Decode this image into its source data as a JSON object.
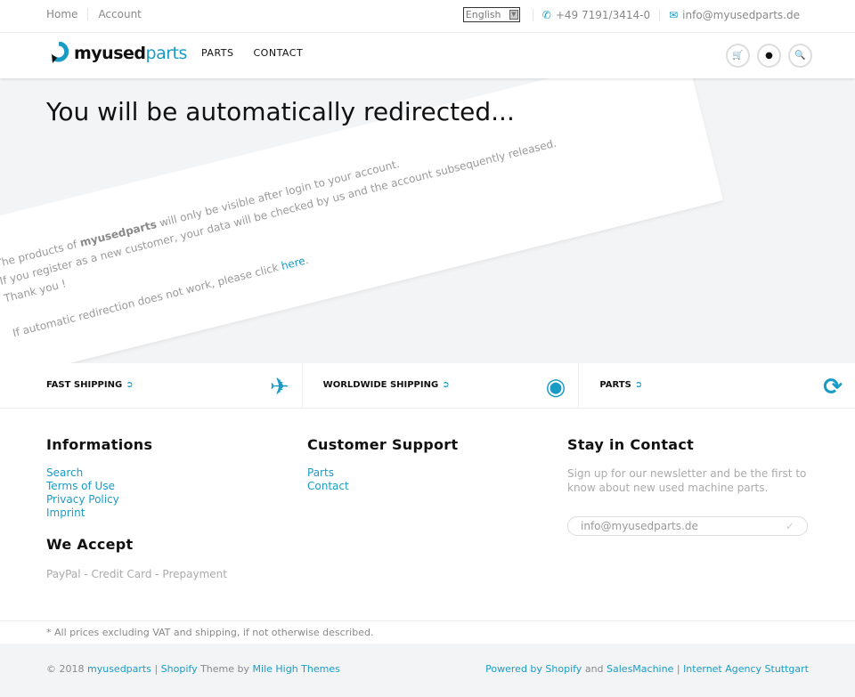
{
  "topbar": {
    "links": [
      "Home",
      "Account"
    ],
    "language": "English",
    "phone": "+49 7191/3414-0",
    "email": "info@myusedparts.de"
  },
  "header": {
    "logo_a": "myused",
    "logo_b": "parts",
    "nav": [
      "PARTS",
      "CONTACT"
    ]
  },
  "main": {
    "title": "You will be automatically redirected...",
    "line1_pre": "The products of ",
    "line1_bold": "myusedparts",
    "line1_post": " will only be visible after login to your account.",
    "line2": "If you register as a new customer, your data will be checked by us and the account subsequently released.",
    "line3": "Thank you !",
    "line4_pre": "If automatic redirection does not work, please click ",
    "line4_link": "here",
    "line4_post": "."
  },
  "features": [
    {
      "label": "FAST SHIPPING",
      "icon": "plane-icon"
    },
    {
      "label": "WORLDWIDE SHIPPING",
      "icon": "compass-icon"
    },
    {
      "label": "PARTS",
      "icon": "refresh-icon"
    }
  ],
  "footer": {
    "informations": {
      "title": "Informations",
      "links": [
        "Search",
        "Terms of Use",
        "Privacy Policy",
        "Imprint"
      ]
    },
    "accept": {
      "title": "We Accept",
      "text": "PayPal - Credit Card - Prepayment"
    },
    "support": {
      "title": "Customer Support",
      "links": [
        "Parts",
        "Contact"
      ]
    },
    "contact": {
      "title": "Stay in Contact",
      "text": "Sign up for our newsletter and be the first to know about new used machine parts.",
      "placeholder": "info@myusedparts.de"
    }
  },
  "note": "* All prices excluding VAT and shipping, if not otherwise described.",
  "bottom": {
    "copy": "© 2018 ",
    "brand": "myusedparts",
    "sep": " | ",
    "shopify": "Shopify",
    "theme_by": " Theme by ",
    "mht": "Mile High Themes",
    "powered": "Powered by Shopify",
    "and": " and ",
    "sm": "SalesMachine",
    "sep2": " | ",
    "agency": "Internet Agency Stuttgart"
  },
  "colors": {
    "accent": "#1a9bc6",
    "background": "#f2f4f5"
  }
}
